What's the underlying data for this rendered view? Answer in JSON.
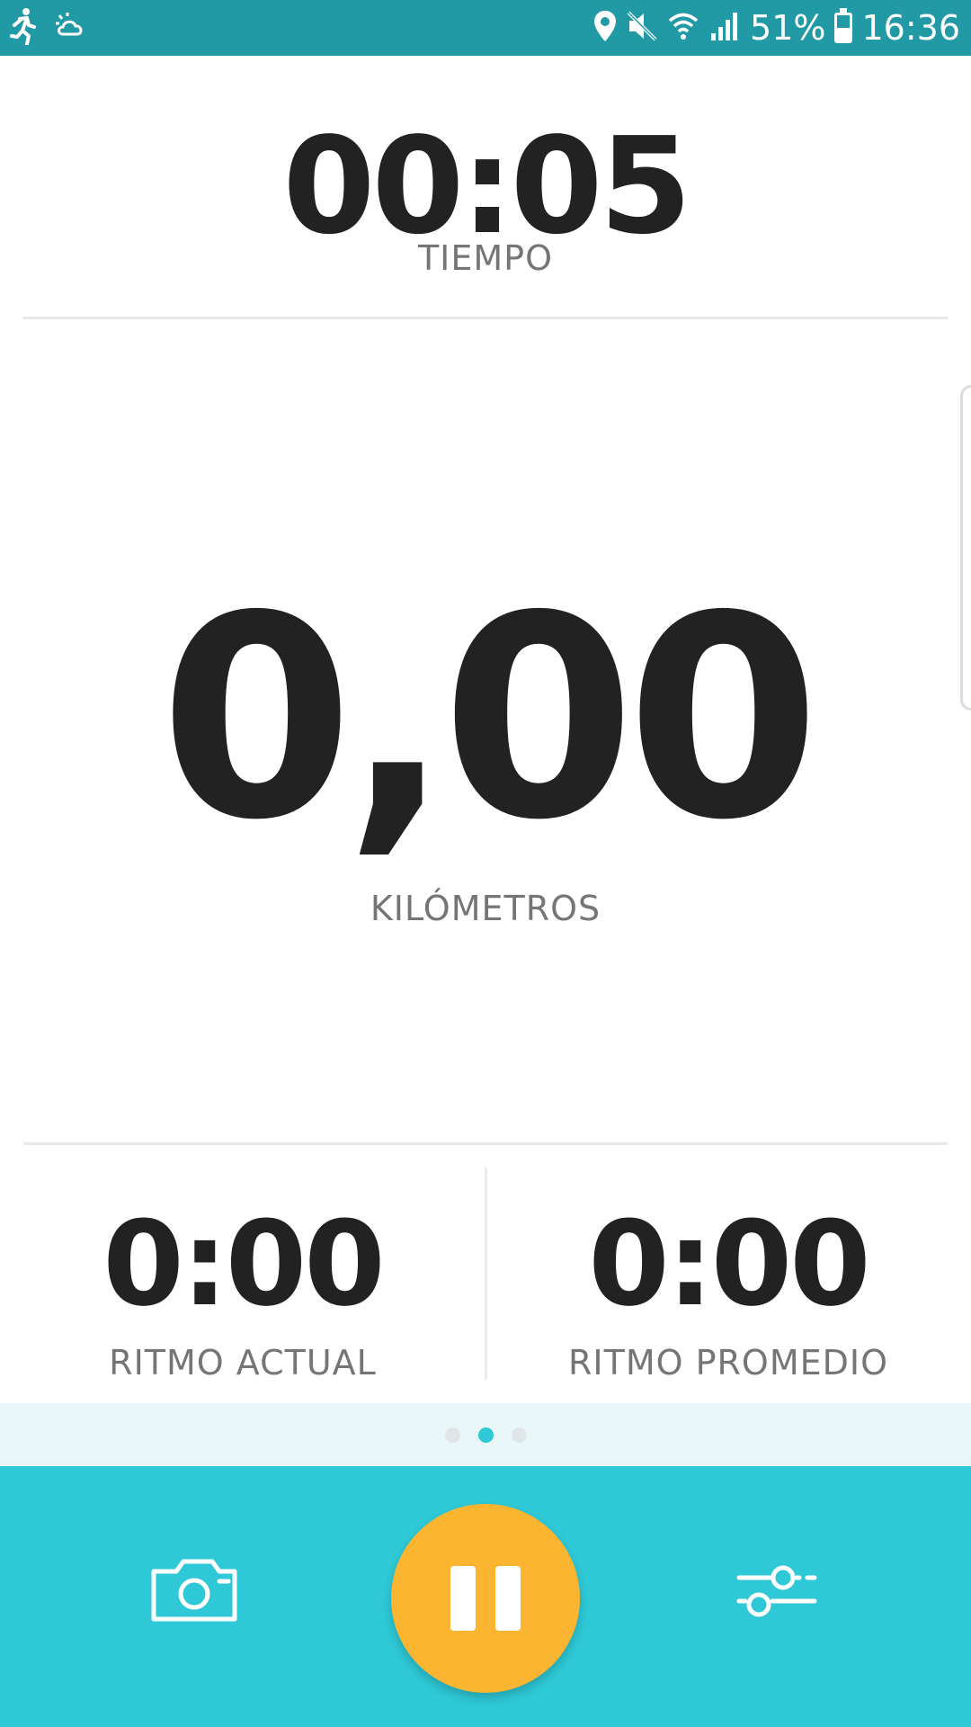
{
  "status_bar": {
    "battery_text": "51%",
    "battery_level": 0.51,
    "time": "16:36",
    "icons_left": [
      "runner-icon",
      "weather-icon"
    ],
    "icons_right": [
      "location-icon",
      "mute-icon",
      "wifi-icon",
      "signal-icon",
      "battery-icon"
    ]
  },
  "workout": {
    "time_value": "00:05",
    "time_label": "TIEMPO",
    "distance_value": "0,00",
    "distance_label": "KILÓMETROS",
    "current_pace_value": "0:00",
    "current_pace_label": "RITMO ACTUAL",
    "average_pace_value": "0:00",
    "average_pace_label": "RITMO PROMEDIO"
  },
  "pager": {
    "pages": 3,
    "active_index": 1
  },
  "controls": {
    "camera_icon": "camera-icon",
    "pause_icon": "pause-icon",
    "settings_icon": "sliders-icon"
  },
  "colors": {
    "status_bar": "#219aa6",
    "control_bar": "#2ec8d6",
    "pause_button": "#fbb531",
    "value_text": "#222222",
    "label_text": "#757575",
    "pager_bg": "#eaf7f8",
    "pager_dot_active": "#2ec8d6",
    "pager_dot_inactive": "#e0e6e7"
  }
}
